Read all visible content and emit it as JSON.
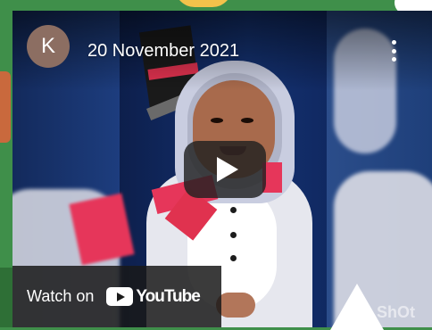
{
  "video": {
    "channel_initial": "K",
    "title": "20 November 2021",
    "watch_on_label": "Watch on",
    "youtube_wordmark": "YouTube",
    "watermark": "ShOt"
  },
  "colors": {
    "page_background": "#3f8f4a",
    "play_button_bg": "#212121",
    "avatar_bg": "#8c6e62",
    "scarf_red": "#e6365a"
  },
  "icons": [
    "more-vertical-icon",
    "play-icon",
    "youtube-logo-icon"
  ]
}
